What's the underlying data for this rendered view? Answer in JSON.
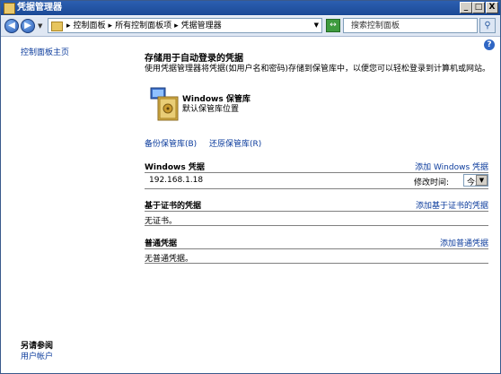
{
  "window": {
    "title": "凭据管理器"
  },
  "titlebar_buttons": {
    "minimize": "_",
    "maximize": "□",
    "close": "X"
  },
  "address": {
    "crumbs": [
      "▸",
      "控制面板",
      "▸",
      "所有控制面板项",
      "▸",
      "凭据管理器"
    ],
    "search_placeholder": "搜索控制面板"
  },
  "help_icon": "?",
  "sidebar": {
    "home_link": "控制面板主页",
    "see_also_heading": "另请参阅",
    "see_also_link": "用户帐户"
  },
  "main": {
    "heading": "存储用于自动登录的凭据",
    "description": "使用凭据管理器将凭据(如用户名和密码)存储到保管库中，以便您可以轻松登录到计算机或网站。",
    "vault_name": "Windows 保管库",
    "vault_location": "默认保管库位置",
    "backup_link": "备份保管库(B)",
    "restore_link": "还原保管库(R)",
    "windows_section": {
      "title": "Windows 凭据",
      "add_link": "添加 Windows 凭据",
      "entry": "192.168.1.18",
      "modified_label": "修改时间:",
      "modified_value": "今天"
    },
    "cert_section": {
      "title": "基于证书的凭据",
      "add_link": "添加基于证书的凭据",
      "empty": "无证书。"
    },
    "generic_section": {
      "title": "普通凭据",
      "add_link": "添加普通凭据",
      "empty": "无普通凭据。"
    }
  }
}
